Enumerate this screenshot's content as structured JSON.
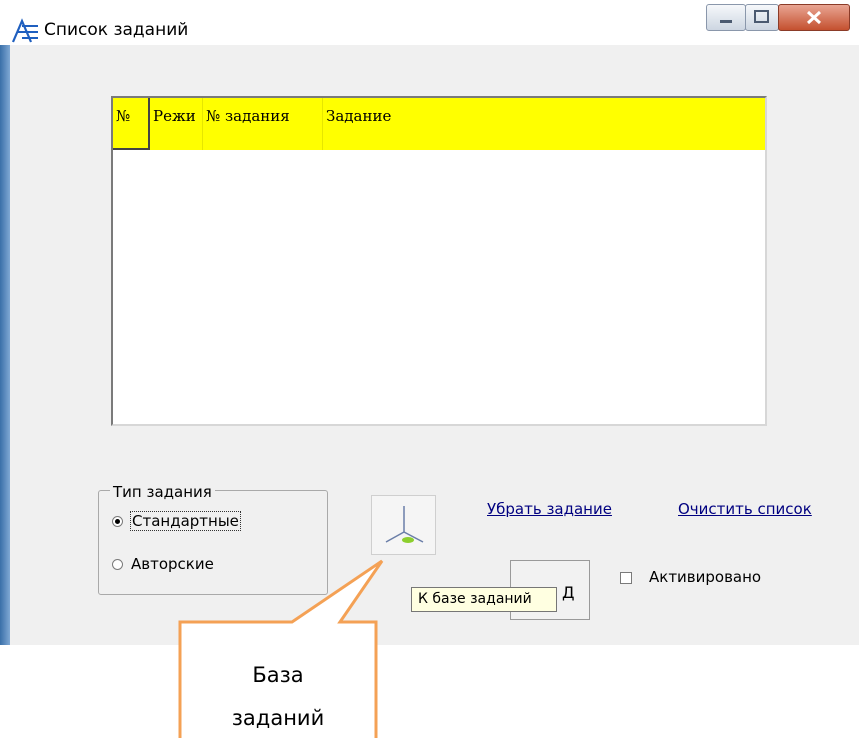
{
  "window": {
    "title": "Список заданий",
    "buttons": [
      "minimize",
      "maximize",
      "close"
    ]
  },
  "list": {
    "columns": [
      "№",
      "Режи",
      "№ задания",
      "Задание"
    ],
    "header_color": "#ffff00",
    "rows": []
  },
  "task_type": {
    "group_title": "Тип задания",
    "options": [
      {
        "label": "Стандартные",
        "selected": true
      },
      {
        "label": "Авторские",
        "selected": false
      }
    ]
  },
  "links": {
    "remove_task": "Убрать задание",
    "clear_list": "Очистить список"
  },
  "activated": {
    "label": "Активировано",
    "checked": false
  },
  "partial_button_glyph": "Д",
  "tooltip": "К базе заданий",
  "callout": {
    "line1": "База",
    "line2": "заданий",
    "color": "#f4a155"
  },
  "icons": {
    "app": "app-logo-icon",
    "task_base": "task-base-icon"
  }
}
